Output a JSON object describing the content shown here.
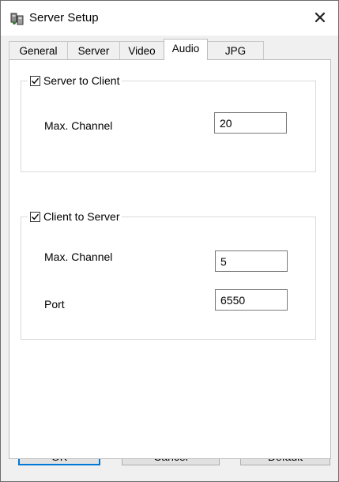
{
  "window": {
    "title": "Server Setup",
    "close_glyph": "✕"
  },
  "tabs": [
    {
      "label": "General"
    },
    {
      "label": "Server"
    },
    {
      "label": "Video"
    },
    {
      "label": "Audio",
      "active": true
    },
    {
      "label": "JPG"
    }
  ],
  "server_to_client": {
    "title": "Server to Client",
    "checked": true,
    "max_channel_label": "Max. Channel",
    "max_channel_value": "20"
  },
  "client_to_server": {
    "title": "Client to Server",
    "checked": true,
    "max_channel_label": "Max. Channel",
    "max_channel_value": "5",
    "port_label": "Port",
    "port_value": "6550"
  },
  "buttons": {
    "ok": "OK",
    "cancel": "Cancel",
    "default": "Default"
  },
  "icons": {
    "app": "server-setup-icon",
    "close": "close-icon",
    "check": "checkmark-icon"
  },
  "colors": {
    "focus_border": "#0078d7",
    "panel": "#ffffff",
    "dialog": "#f0f0f0"
  }
}
